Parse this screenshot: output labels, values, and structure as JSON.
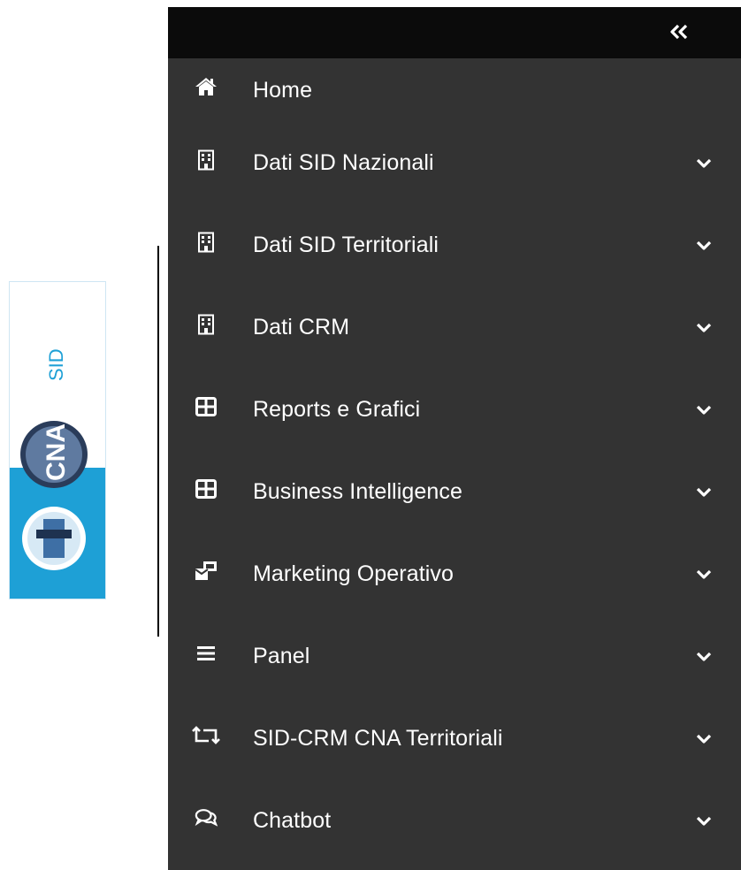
{
  "logo": {
    "brand_text": "CNA",
    "product_text": "SID"
  },
  "sidebar": {
    "collapse_glyph": "«",
    "items": [
      {
        "label": "Home",
        "icon": "home-icon",
        "expandable": false
      },
      {
        "label": "Dati SID Nazionali",
        "icon": "building-icon",
        "expandable": true
      },
      {
        "label": "Dati SID Territoriali",
        "icon": "building-icon",
        "expandable": true
      },
      {
        "label": "Dati CRM",
        "icon": "building-icon",
        "expandable": true
      },
      {
        "label": "Reports e Grafici",
        "icon": "table-icon",
        "expandable": true
      },
      {
        "label": "Business Intelligence",
        "icon": "table-icon",
        "expandable": true
      },
      {
        "label": "Marketing Operativo",
        "icon": "mail-bulk-icon",
        "expandable": true
      },
      {
        "label": "Panel",
        "icon": "bars-icon",
        "expandable": true
      },
      {
        "label": "SID-CRM CNA Territoriali",
        "icon": "retweet-icon",
        "expandable": true
      },
      {
        "label": "Chatbot",
        "icon": "comments-icon",
        "expandable": true
      }
    ]
  },
  "colors": {
    "sidebar_bg": "#333333",
    "topbar_bg": "#0b0b0b",
    "logo_blue": "#1ea0d6"
  }
}
